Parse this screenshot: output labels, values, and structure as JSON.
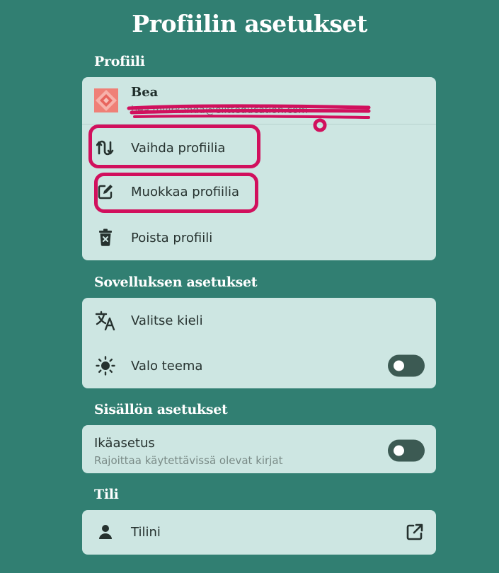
{
  "page_title": "Profiilin asetukset",
  "sections": {
    "profile": {
      "title": "Profiili",
      "user_name": "Bea",
      "user_email": "bea.mvirkanda@elitteducation.com",
      "items": [
        {
          "label": "Vaihda profiilia",
          "icon": "switch-arrows-icon"
        },
        {
          "label": "Muokkaa profiilia",
          "icon": "edit-icon"
        },
        {
          "label": "Poista profiili",
          "icon": "trash-icon"
        }
      ]
    },
    "app": {
      "title": "Sovelluksen asetukset",
      "language_label": "Valitse kieli",
      "theme_label": "Valo teema",
      "theme_toggle_on": false
    },
    "content": {
      "title": "Sisällön asetukset",
      "age_label": "Ikäasetus",
      "age_description": "Rajoittaa käytettävissä olevat kirjat",
      "age_toggle_on": false
    },
    "account": {
      "title": "Tili",
      "my_account_label": "Tilini"
    }
  },
  "colors": {
    "background": "#317f72",
    "card": "#cde6e2",
    "toggle": "#3c5a53",
    "annotation": "#d1105d"
  }
}
